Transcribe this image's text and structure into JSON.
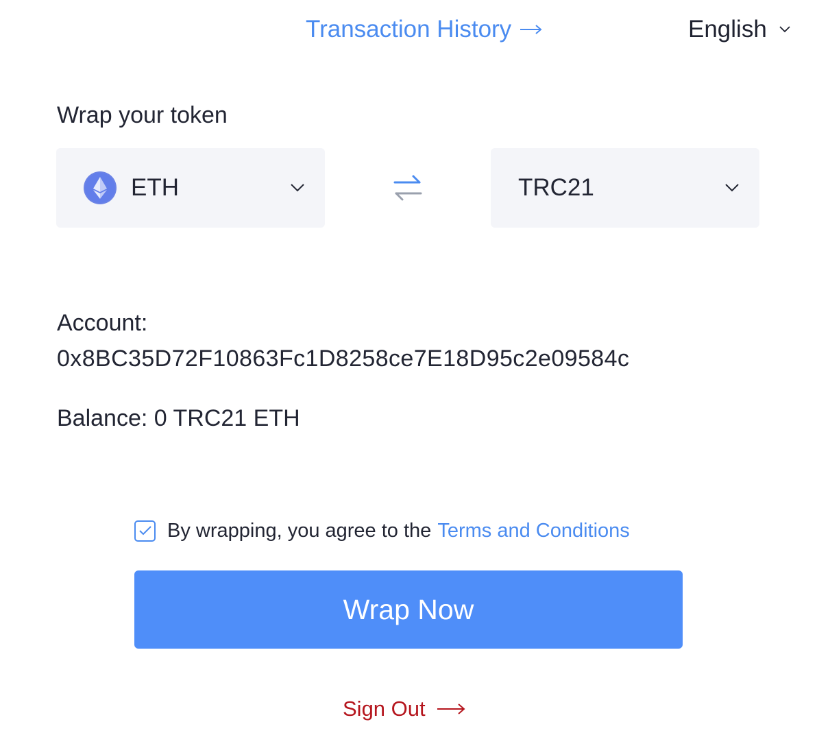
{
  "header": {
    "history_label": "Transaction History",
    "language": "English"
  },
  "wrap": {
    "title": "Wrap your token",
    "from_token": "ETH",
    "to_token": "TRC21"
  },
  "account": {
    "label": "Account:",
    "address": "0x8BC35D72F10863Fc1D8258ce7E18D95c2e09584c",
    "balance": "Balance: 0 TRC21 ETH"
  },
  "agreement": {
    "checked": true,
    "text": "By wrapping, you agree to the",
    "terms_label": "Terms and Conditions"
  },
  "actions": {
    "wrap_label": "Wrap Now",
    "signout_label": "Sign Out"
  },
  "colors": {
    "accent": "#4f8ef9",
    "link": "#4a8bf0",
    "danger": "#b5151d",
    "select_bg": "#f4f5f9"
  },
  "icons": {
    "history_arrow": "arrow-right-icon",
    "language_chevron": "chevron-down-icon",
    "eth_logo": "ethereum-logo-icon",
    "swap": "swap-arrows-icon",
    "checkbox": "checkmark-icon",
    "signout_arrow": "arrow-right-icon"
  }
}
